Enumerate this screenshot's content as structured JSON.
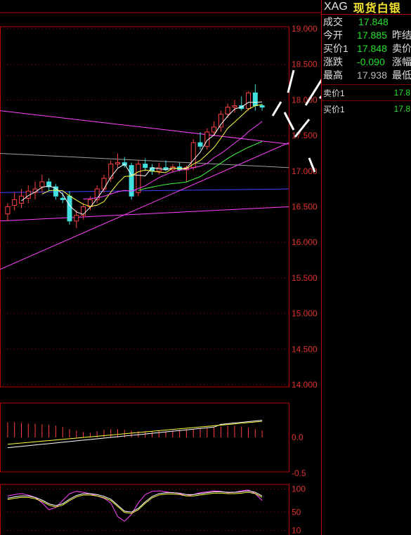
{
  "quote_panel": {
    "symbol": "XAG",
    "name": "现货白银",
    "rows": [
      {
        "label": "成交",
        "value": "17.848",
        "label2": ""
      },
      {
        "label": "今开",
        "value": "17.885",
        "label2": "昨结"
      },
      {
        "label": "买价1",
        "value": "17.848",
        "label2": "卖价"
      },
      {
        "label": "涨跌",
        "value": "-0.090",
        "label2": "涨幅"
      },
      {
        "label": "最高",
        "value": "17.938",
        "label2": "最低"
      }
    ],
    "sub_rows": [
      {
        "label": "卖价1",
        "value": "17.8"
      },
      {
        "label": "买价1",
        "value": "17.8"
      }
    ]
  },
  "colors": {
    "up": "#ff4040",
    "down": "#40e0e0",
    "grid": "#8b0000",
    "ma_white": "#ffffff",
    "ma_yellow": "#ffff40",
    "ma_magenta": "#ff40ff",
    "ma_green": "#40ff40",
    "ma_blue": "#4040ff",
    "ma_gray": "#a0a0a0"
  },
  "chart_data": [
    {
      "type": "candlestick",
      "y_ticks": [
        "19.000",
        "18.500",
        "18.000",
        "17.500",
        "17.000",
        "16.500",
        "16.000",
        "15.500",
        "15.000",
        "14.500",
        "14.000"
      ],
      "ylim": [
        14.0,
        19.0
      ],
      "candles": [
        {
          "o": 16.4,
          "h": 16.55,
          "l": 16.3,
          "c": 16.5
        },
        {
          "o": 16.52,
          "h": 16.7,
          "l": 16.45,
          "c": 16.6
        },
        {
          "o": 16.55,
          "h": 16.75,
          "l": 16.48,
          "c": 16.65
        },
        {
          "o": 16.62,
          "h": 16.8,
          "l": 16.55,
          "c": 16.72
        },
        {
          "o": 16.7,
          "h": 16.85,
          "l": 16.6,
          "c": 16.75
        },
        {
          "o": 16.78,
          "h": 16.95,
          "l": 16.7,
          "c": 16.85
        },
        {
          "o": 16.85,
          "h": 16.9,
          "l": 16.72,
          "c": 16.78
        },
        {
          "o": 16.78,
          "h": 16.82,
          "l": 16.6,
          "c": 16.65
        },
        {
          "o": 16.62,
          "h": 16.7,
          "l": 16.55,
          "c": 16.6
        },
        {
          "o": 16.65,
          "h": 16.72,
          "l": 16.25,
          "c": 16.3
        },
        {
          "o": 16.3,
          "h": 16.45,
          "l": 16.2,
          "c": 16.38
        },
        {
          "o": 16.38,
          "h": 16.55,
          "l": 16.32,
          "c": 16.5
        },
        {
          "o": 16.5,
          "h": 16.65,
          "l": 16.45,
          "c": 16.6
        },
        {
          "o": 16.6,
          "h": 16.8,
          "l": 16.55,
          "c": 16.75
        },
        {
          "o": 16.75,
          "h": 16.95,
          "l": 16.7,
          "c": 16.9
        },
        {
          "o": 16.9,
          "h": 17.15,
          "l": 16.85,
          "c": 17.1
        },
        {
          "o": 17.1,
          "h": 17.25,
          "l": 17.05,
          "c": 17.12
        },
        {
          "o": 17.12,
          "h": 17.2,
          "l": 17.05,
          "c": 17.08
        },
        {
          "o": 17.08,
          "h": 17.12,
          "l": 16.6,
          "c": 16.65
        },
        {
          "o": 16.7,
          "h": 17.15,
          "l": 16.65,
          "c": 17.1
        },
        {
          "o": 17.1,
          "h": 17.18,
          "l": 17.0,
          "c": 17.05
        },
        {
          "o": 17.05,
          "h": 17.1,
          "l": 16.95,
          "c": 17.0
        },
        {
          "o": 17.0,
          "h": 17.12,
          "l": 16.95,
          "c": 17.05
        },
        {
          "o": 17.05,
          "h": 17.15,
          "l": 17.0,
          "c": 17.02
        },
        {
          "o": 17.02,
          "h": 17.1,
          "l": 16.98,
          "c": 17.06
        },
        {
          "o": 17.06,
          "h": 17.12,
          "l": 17.0,
          "c": 17.02
        },
        {
          "o": 17.02,
          "h": 17.08,
          "l": 16.85,
          "c": 17.05
        },
        {
          "o": 17.05,
          "h": 17.45,
          "l": 17.02,
          "c": 17.4
        },
        {
          "o": 17.4,
          "h": 17.55,
          "l": 17.3,
          "c": 17.35
        },
        {
          "o": 17.35,
          "h": 17.6,
          "l": 17.3,
          "c": 17.55
        },
        {
          "o": 17.55,
          "h": 17.7,
          "l": 17.5,
          "c": 17.62
        },
        {
          "o": 17.62,
          "h": 17.85,
          "l": 17.55,
          "c": 17.8
        },
        {
          "o": 17.8,
          "h": 17.95,
          "l": 17.75,
          "c": 17.9
        },
        {
          "o": 17.9,
          "h": 18.0,
          "l": 17.82,
          "c": 17.92
        },
        {
          "o": 17.92,
          "h": 18.05,
          "l": 17.85,
          "c": 17.88
        },
        {
          "o": 17.88,
          "h": 18.12,
          "l": 17.85,
          "c": 18.1
        },
        {
          "o": 18.1,
          "h": 18.22,
          "l": 17.85,
          "c": 17.92
        },
        {
          "o": 17.92,
          "h": 17.95,
          "l": 17.85,
          "c": 17.9
        }
      ],
      "ma_lines": [
        {
          "color": "ma_white",
          "points": [
            [
              16.0,
              16.35,
              16.55,
              16.6,
              16.2,
              16.55,
              16.8,
              17.05,
              17.0,
              17.05,
              17.7,
              17.9
            ]
          ]
        },
        {
          "color": "ma_yellow",
          "points": [
            [
              16.3,
              16.55,
              16.7,
              16.45,
              16.5,
              16.85,
              17.0,
              17.0,
              17.1,
              17.3,
              17.65,
              17.8
            ]
          ]
        }
      ],
      "long_ma": [
        {
          "color": "ma_magenta",
          "from": 17.85,
          "to": 17.38
        },
        {
          "color": "ma_gray",
          "from": 17.25,
          "to": 17.05
        },
        {
          "color": "ma_blue",
          "from": 16.7,
          "to": 16.75
        },
        {
          "color": "ma_magenta",
          "from": 15.62,
          "to": 17.4
        },
        {
          "color": "ma_magenta",
          "from": 16.3,
          "to": 16.5
        }
      ]
    },
    {
      "type": "bar",
      "name": "macd",
      "y_ticks": [
        "0.0",
        "-0.5"
      ],
      "ylim": [
        -0.5,
        0.5
      ],
      "values": [
        0.22,
        0.22,
        0.21,
        0.2,
        0.2,
        0.19,
        0.18,
        0.17,
        0.15,
        0.12,
        0.1,
        0.08,
        0.07,
        0.09,
        0.11,
        0.12,
        0.12,
        0.11,
        0.1,
        0.09,
        0.09,
        0.08,
        0.09,
        0.09,
        0.1,
        0.11,
        0.12,
        0.12,
        0.13,
        0.14,
        0.15,
        0.16,
        0.17,
        0.17,
        0.16,
        0.14,
        0.12,
        0.1
      ]
    },
    {
      "type": "line",
      "name": "kdj",
      "y_ticks": [
        "100",
        "50",
        "10"
      ],
      "ylim": [
        0,
        110
      ]
    }
  ]
}
